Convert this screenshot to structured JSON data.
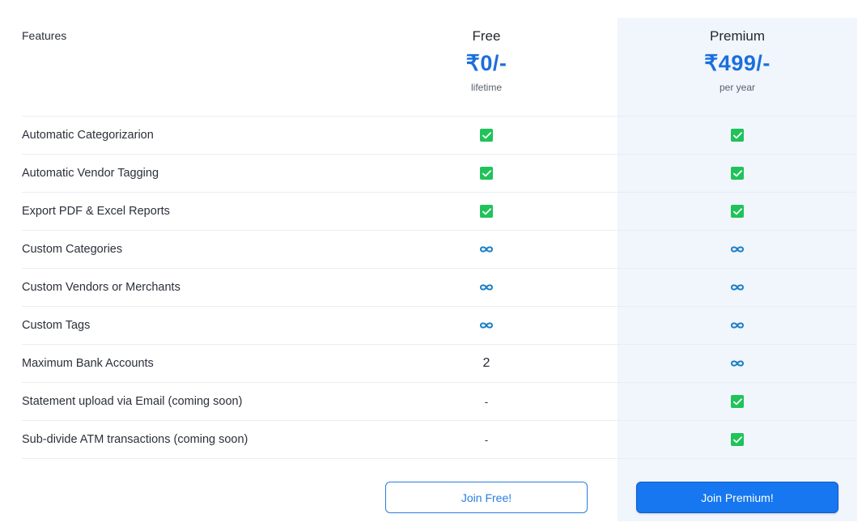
{
  "header": {
    "features_label": "Features",
    "plans": [
      {
        "name": "Free",
        "price": "₹0/-",
        "period": "lifetime"
      },
      {
        "name": "Premium",
        "price": "₹499/-",
        "period": "per year"
      }
    ]
  },
  "features": [
    {
      "label": "Automatic Categorizarion",
      "free": {
        "type": "check"
      },
      "premium": {
        "type": "check"
      }
    },
    {
      "label": "Automatic Vendor Tagging",
      "free": {
        "type": "check"
      },
      "premium": {
        "type": "check"
      }
    },
    {
      "label": "Export PDF & Excel Reports",
      "free": {
        "type": "check"
      },
      "premium": {
        "type": "check"
      }
    },
    {
      "label": "Custom Categories",
      "free": {
        "type": "infinity"
      },
      "premium": {
        "type": "infinity"
      }
    },
    {
      "label": "Custom Vendors or Merchants",
      "free": {
        "type": "infinity"
      },
      "premium": {
        "type": "infinity"
      }
    },
    {
      "label": "Custom Tags",
      "free": {
        "type": "infinity"
      },
      "premium": {
        "type": "infinity"
      }
    },
    {
      "label": "Maximum Bank Accounts",
      "free": {
        "type": "text",
        "text": "2"
      },
      "premium": {
        "type": "infinity"
      }
    },
    {
      "label": "Statement upload via Email (coming soon)",
      "free": {
        "type": "text",
        "text": "-"
      },
      "premium": {
        "type": "check"
      }
    },
    {
      "label": "Sub-divide ATM transactions (coming soon)",
      "free": {
        "type": "text",
        "text": "-"
      },
      "premium": {
        "type": "check"
      }
    }
  ],
  "buttons": {
    "free_label": "Join Free!",
    "premium_label": "Join Premium!"
  },
  "colors": {
    "accent": "#1677f0",
    "price": "#1a6fdc",
    "check": "#20c35a",
    "infinity": "#1b7fc4",
    "premium_bg": "#f1f5fc"
  },
  "icons": {
    "check": "checkbox-checked-icon",
    "infinity": "infinity-icon"
  }
}
